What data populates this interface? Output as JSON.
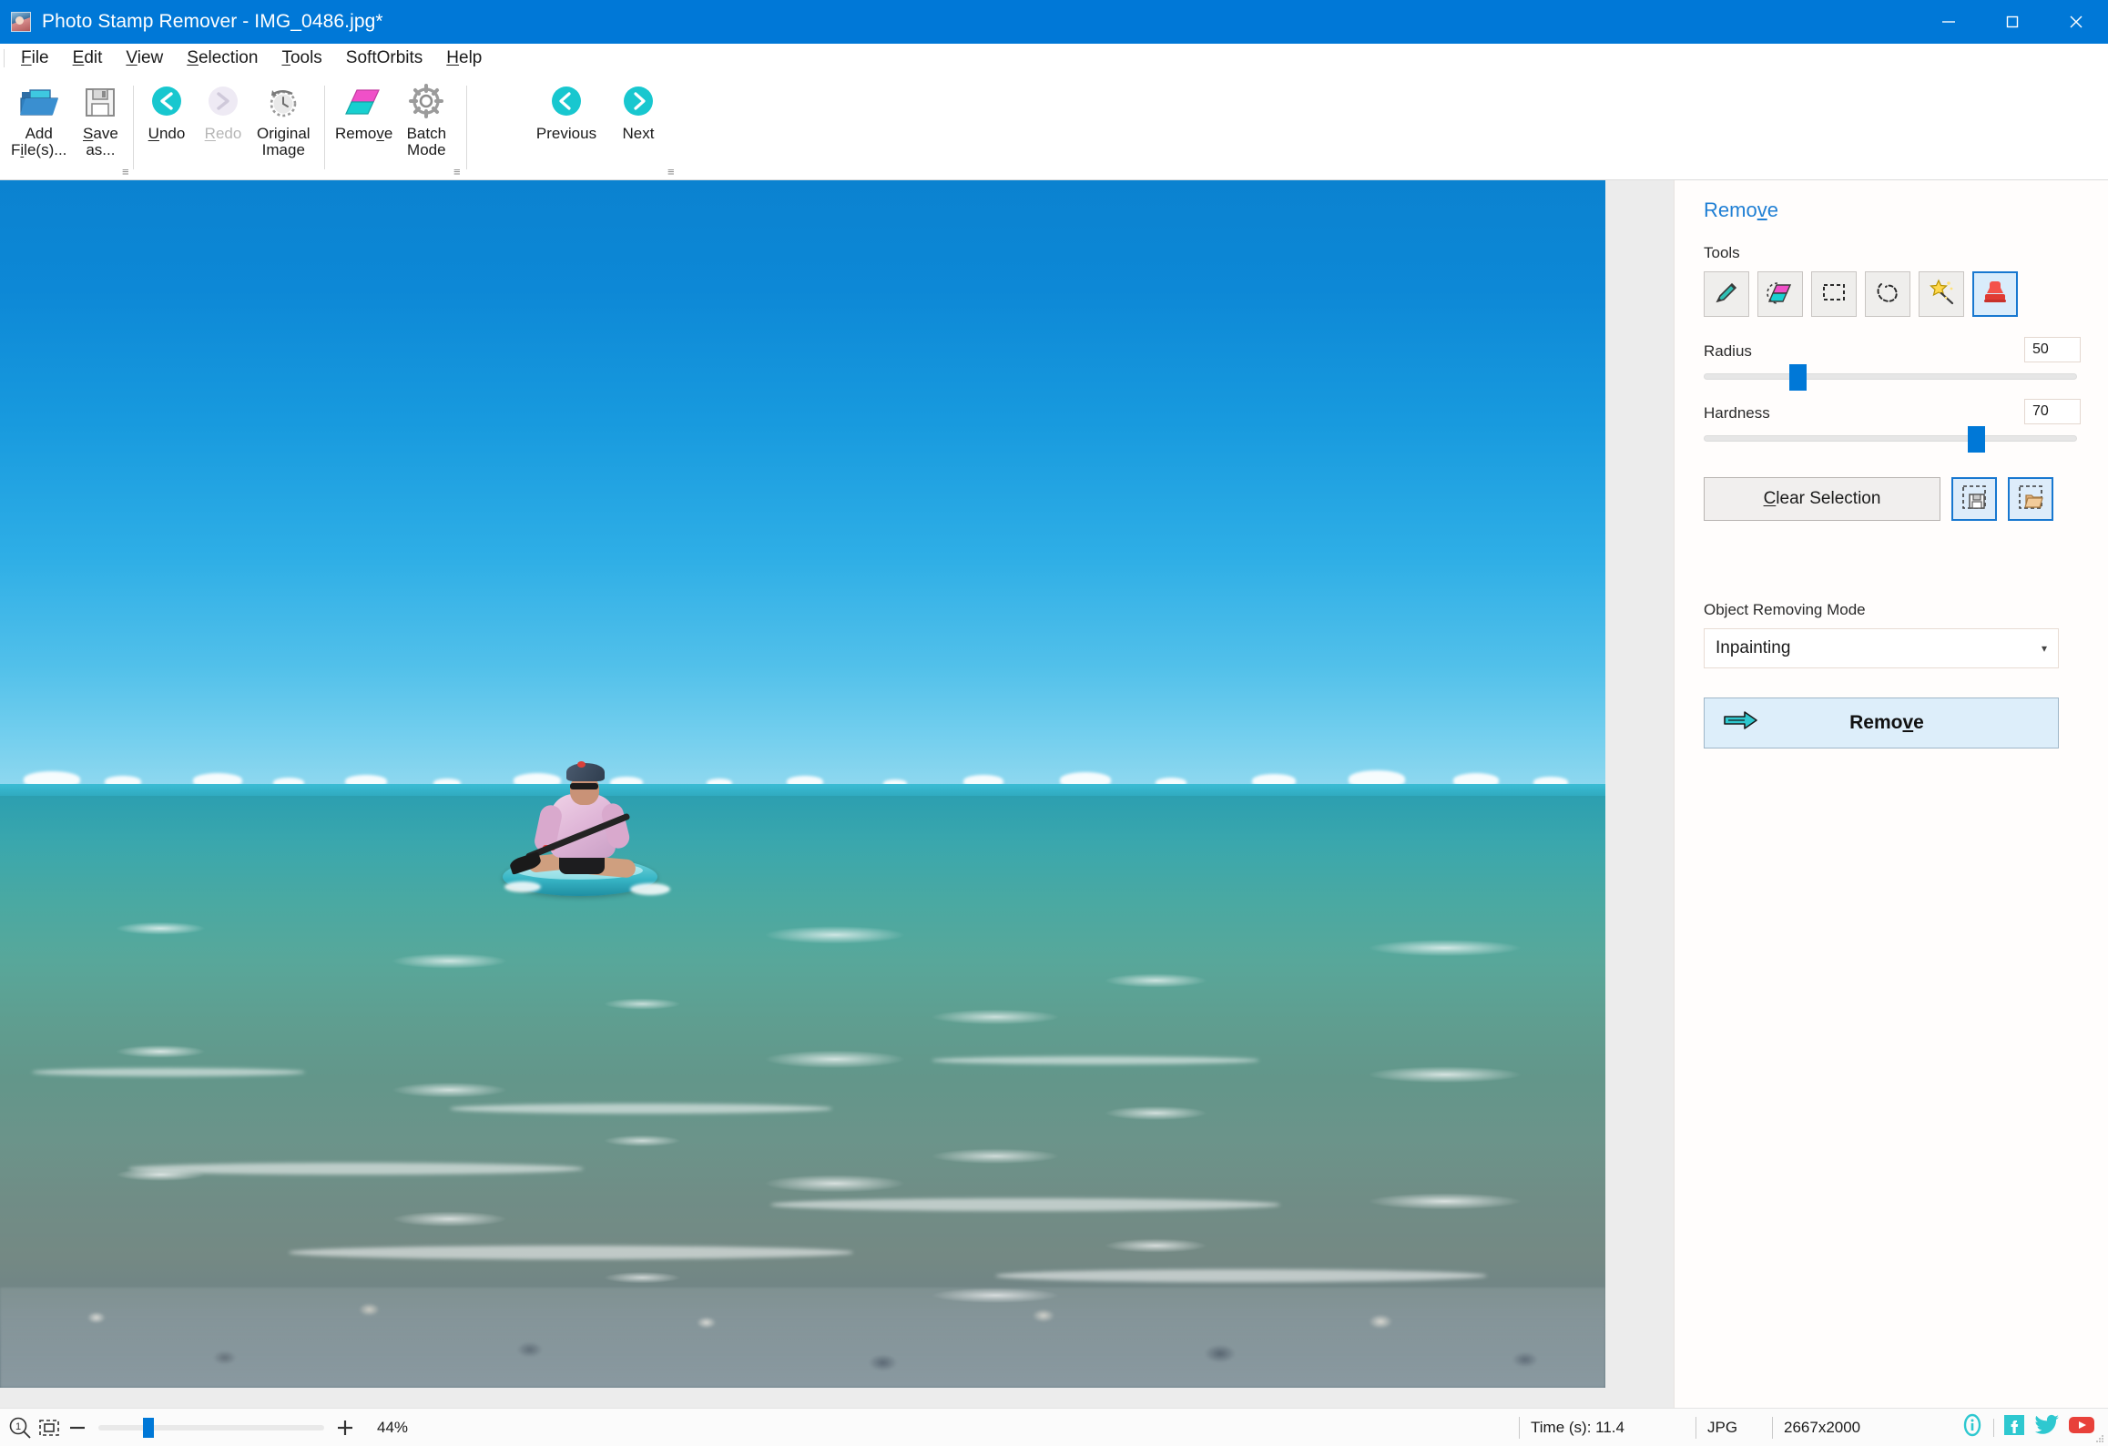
{
  "window": {
    "title": "Photo Stamp Remover - IMG_0486.jpg*",
    "app_icon": "photo-app-icon",
    "minimize_label": "Minimize",
    "maximize_label": "Restore",
    "close_label": "Close"
  },
  "menubar": {
    "items": [
      {
        "label": "File",
        "accel": "F"
      },
      {
        "label": "Edit",
        "accel": "E"
      },
      {
        "label": "View",
        "accel": "V"
      },
      {
        "label": "Selection",
        "accel": "S"
      },
      {
        "label": "Tools",
        "accel": "T"
      },
      {
        "label": "SoftOrbits",
        "accel": ""
      },
      {
        "label": "Help",
        "accel": "H"
      }
    ]
  },
  "toolbar": {
    "groups": [
      {
        "name": "file",
        "buttons": [
          {
            "label": "Add\nFile(s)...",
            "icon": "open-folder-icon",
            "enabled": true,
            "accel": "i"
          },
          {
            "label": "Save\nas...",
            "icon": "floppy-disk-icon",
            "enabled": true,
            "accel": "S"
          }
        ]
      },
      {
        "name": "history",
        "buttons": [
          {
            "label": "Undo",
            "icon": "undo-arrow-icon",
            "enabled": true,
            "accel": "U"
          },
          {
            "label": "Redo",
            "icon": "redo-arrow-icon",
            "enabled": false,
            "accel": "R"
          },
          {
            "label": "Original\nImage",
            "icon": "clock-revert-icon",
            "enabled": true
          }
        ]
      },
      {
        "name": "actions",
        "buttons": [
          {
            "label": "Remove",
            "icon": "remove-shapes-icon",
            "enabled": true,
            "accel": "v"
          },
          {
            "label": "Batch\nMode",
            "icon": "gear-icon",
            "enabled": true
          }
        ]
      },
      {
        "name": "navigation",
        "buttons": [
          {
            "label": "Previous",
            "icon": "previous-circle-icon",
            "enabled": true
          },
          {
            "label": "Next",
            "icon": "next-circle-icon",
            "enabled": true
          }
        ]
      }
    ],
    "overflow_icon": "overflow-chevron-icon"
  },
  "canvas": {
    "image_name": "IMG_0486.jpg",
    "scene_description": "Person in pink shirt paddling a teal stand-up paddleboard on shallow turquoise sea under clear blue sky"
  },
  "panel": {
    "title": "Remove",
    "title_accel": "v",
    "tools_label": "Tools",
    "tools": [
      {
        "name": "marker-tool",
        "icon": "marker-pen-icon",
        "active": false
      },
      {
        "name": "eraser-tool",
        "icon": "eraser-icon",
        "active": false
      },
      {
        "name": "rectangle-select-tool",
        "icon": "rectangle-select-icon",
        "active": false
      },
      {
        "name": "lasso-tool",
        "icon": "lasso-icon",
        "active": false
      },
      {
        "name": "magic-wand-tool",
        "icon": "magic-wand-icon",
        "active": false
      },
      {
        "name": "stamp-tool",
        "icon": "stamp-icon",
        "active": true
      }
    ],
    "radius": {
      "label": "Radius",
      "value": "50",
      "slider_pct": 25
    },
    "hardness": {
      "label": "Hardness",
      "value": "70",
      "slider_pct": 73
    },
    "clear_selection": {
      "label": "Clear Selection",
      "accel": "C"
    },
    "save_selection": {
      "name": "save-selection-button",
      "icon": "save-selection-icon"
    },
    "load_selection": {
      "name": "load-selection-button",
      "icon": "load-selection-icon"
    },
    "object_removing_mode": {
      "label": "Object Removing Mode",
      "value": "Inpainting",
      "caret_icon": "chevron-down-icon"
    },
    "remove_button": {
      "label": "Remove",
      "accel": "v",
      "icon": "right-arrow-icon"
    }
  },
  "statusbar": {
    "zoom_actual_icon": "zoom-actual-size-icon",
    "fit_screen_icon": "fit-to-screen-icon",
    "zoom_out_icon": "minus-icon",
    "zoom_in_icon": "plus-icon",
    "zoom_percent": "44%",
    "zoom_slider_pct": 22,
    "time_label": "Time (s): 11.4",
    "format": "JPG",
    "dimensions": "2667x2000",
    "social": [
      {
        "name": "info-icon",
        "color": "#2ec8d0"
      },
      {
        "name": "facebook-icon",
        "color": "#2ec8d0"
      },
      {
        "name": "twitter-icon",
        "color": "#2ec8d0"
      },
      {
        "name": "youtube-icon",
        "color": "#e8413a"
      }
    ]
  },
  "colors": {
    "titlebar": "#0078d7",
    "accent": "#0078d7",
    "panel_title": "#1f7fd4",
    "tool_active_border": "#1878d0",
    "remove_button_bg": "#ddeefa",
    "cyan_icon": "#2ec8d0",
    "magenta_icon": "#f050c8",
    "youtube_red": "#e8413a"
  }
}
